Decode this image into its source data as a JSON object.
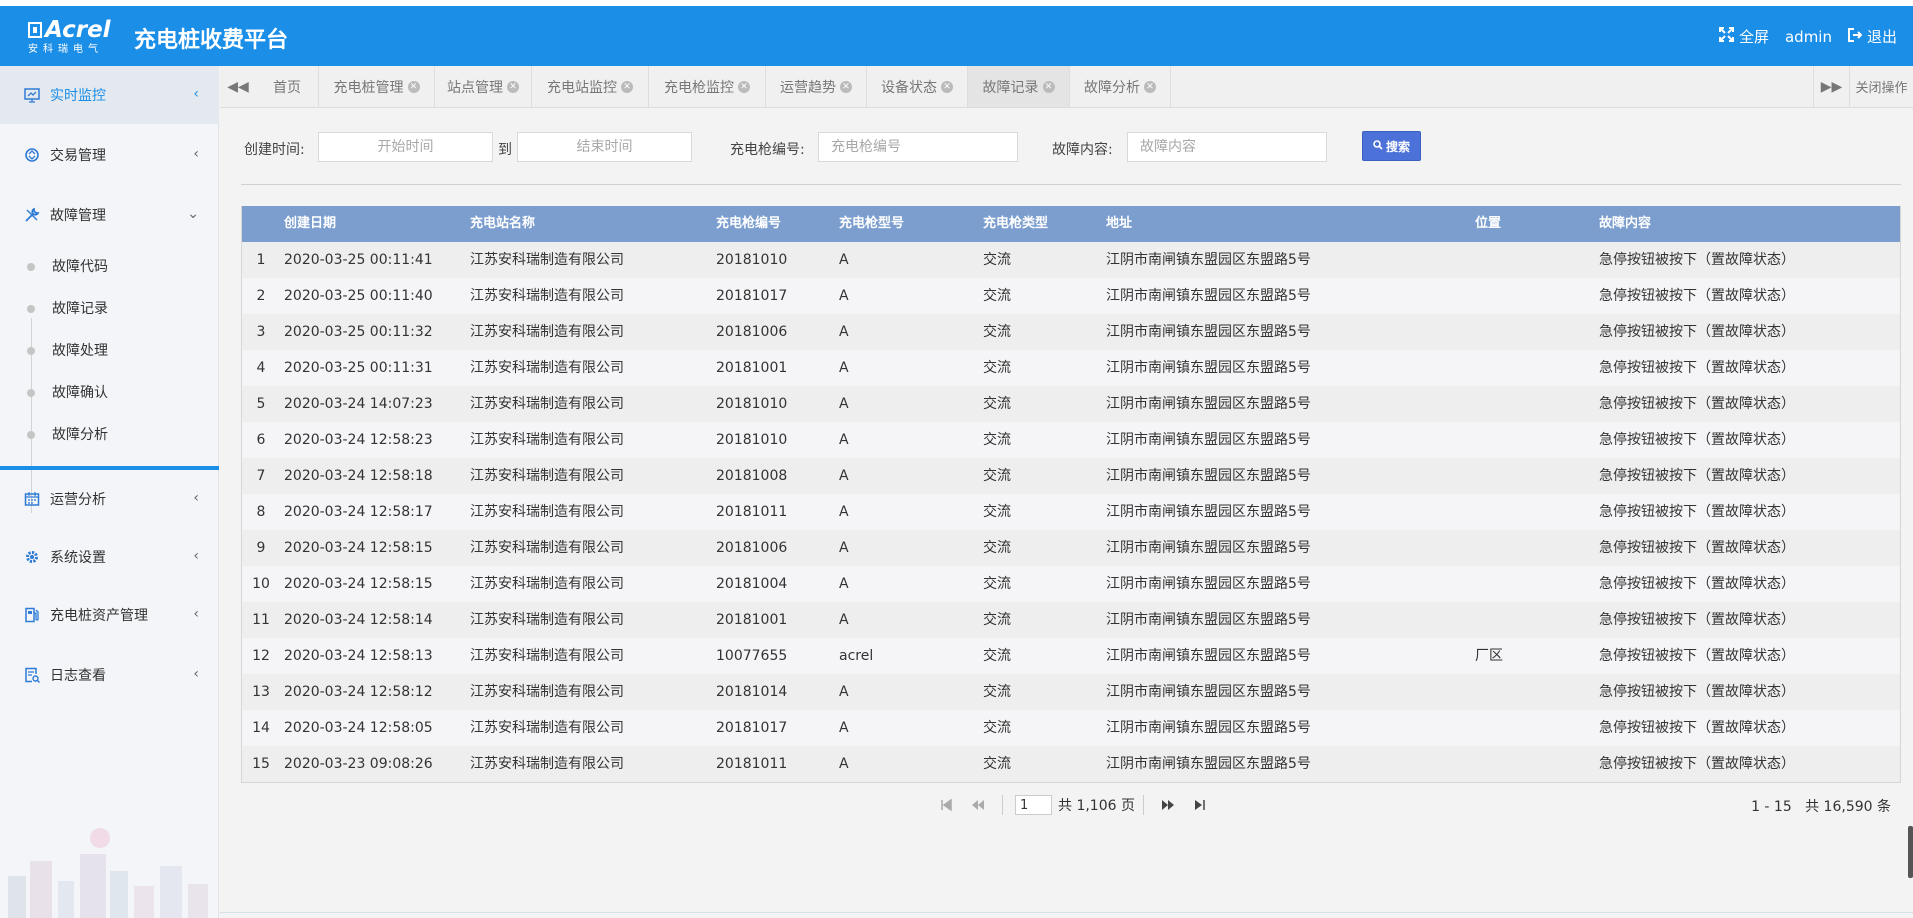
{
  "brand": {
    "logo_text": "Acrel",
    "logo_sub": "安科瑞电气",
    "app_title": "充电桩收费平台"
  },
  "header": {
    "fullscreen_label": "全屏",
    "user": "admin",
    "logout_label": "退出"
  },
  "sidebar": {
    "items": [
      {
        "label": "实时监控",
        "icon": "monitor-icon"
      },
      {
        "label": "交易管理",
        "icon": "exchange-icon"
      },
      {
        "label": "故障管理",
        "icon": "wrench-icon"
      },
      {
        "label": "运营分析",
        "icon": "calendar-icon"
      },
      {
        "label": "系统设置",
        "icon": "gear-icon"
      },
      {
        "label": "充电桩资产管理",
        "icon": "charger-icon"
      },
      {
        "label": "日志查看",
        "icon": "log-icon"
      }
    ],
    "sub_items": [
      "故障代码",
      "故障记录",
      "故障处理",
      "故障确认",
      "故障分析"
    ]
  },
  "tabs": {
    "items": [
      "首页",
      "充电桩管理",
      "站点管理",
      "充电站监控",
      "充电枪监控",
      "运营趋势",
      "设备状态",
      "故障记录",
      "故障分析"
    ],
    "active": "故障记录",
    "close_ops_label": "关闭操作"
  },
  "search": {
    "created_label": "创建时间:",
    "start_placeholder": "开始时间",
    "to_label": "到",
    "end_placeholder": "结束时间",
    "gun_label": "充电枪编号:",
    "gun_placeholder": "充电枪编号",
    "fault_label": "故障内容:",
    "fault_placeholder": "故障内容",
    "button_label": "搜索"
  },
  "table": {
    "columns": [
      "创建日期",
      "充电站名称",
      "充电枪编号",
      "充电枪型号",
      "充电枪类型",
      "地址",
      "位置",
      "故障内容"
    ],
    "rows": [
      {
        "n": "1",
        "date": "2020-03-25 00:11:41",
        "station": "江苏安科瑞制造有限公司",
        "gun_no": "20181010",
        "model": "A",
        "type": "交流",
        "address": "江阴市南闸镇东盟园区东盟路5号",
        "location": "",
        "fault": "急停按钮被按下（置故障状态）"
      },
      {
        "n": "2",
        "date": "2020-03-25 00:11:40",
        "station": "江苏安科瑞制造有限公司",
        "gun_no": "20181017",
        "model": "A",
        "type": "交流",
        "address": "江阴市南闸镇东盟园区东盟路5号",
        "location": "",
        "fault": "急停按钮被按下（置故障状态）"
      },
      {
        "n": "3",
        "date": "2020-03-25 00:11:32",
        "station": "江苏安科瑞制造有限公司",
        "gun_no": "20181006",
        "model": "A",
        "type": "交流",
        "address": "江阴市南闸镇东盟园区东盟路5号",
        "location": "",
        "fault": "急停按钮被按下（置故障状态）"
      },
      {
        "n": "4",
        "date": "2020-03-25 00:11:31",
        "station": "江苏安科瑞制造有限公司",
        "gun_no": "20181001",
        "model": "A",
        "type": "交流",
        "address": "江阴市南闸镇东盟园区东盟路5号",
        "location": "",
        "fault": "急停按钮被按下（置故障状态）"
      },
      {
        "n": "5",
        "date": "2020-03-24 14:07:23",
        "station": "江苏安科瑞制造有限公司",
        "gun_no": "20181010",
        "model": "A",
        "type": "交流",
        "address": "江阴市南闸镇东盟园区东盟路5号",
        "location": "",
        "fault": "急停按钮被按下（置故障状态）"
      },
      {
        "n": "6",
        "date": "2020-03-24 12:58:23",
        "station": "江苏安科瑞制造有限公司",
        "gun_no": "20181010",
        "model": "A",
        "type": "交流",
        "address": "江阴市南闸镇东盟园区东盟路5号",
        "location": "",
        "fault": "急停按钮被按下（置故障状态）"
      },
      {
        "n": "7",
        "date": "2020-03-24 12:58:18",
        "station": "江苏安科瑞制造有限公司",
        "gun_no": "20181008",
        "model": "A",
        "type": "交流",
        "address": "江阴市南闸镇东盟园区东盟路5号",
        "location": "",
        "fault": "急停按钮被按下（置故障状态）"
      },
      {
        "n": "8",
        "date": "2020-03-24 12:58:17",
        "station": "江苏安科瑞制造有限公司",
        "gun_no": "20181011",
        "model": "A",
        "type": "交流",
        "address": "江阴市南闸镇东盟园区东盟路5号",
        "location": "",
        "fault": "急停按钮被按下（置故障状态）"
      },
      {
        "n": "9",
        "date": "2020-03-24 12:58:15",
        "station": "江苏安科瑞制造有限公司",
        "gun_no": "20181006",
        "model": "A",
        "type": "交流",
        "address": "江阴市南闸镇东盟园区东盟路5号",
        "location": "",
        "fault": "急停按钮被按下（置故障状态）"
      },
      {
        "n": "10",
        "date": "2020-03-24 12:58:15",
        "station": "江苏安科瑞制造有限公司",
        "gun_no": "20181004",
        "model": "A",
        "type": "交流",
        "address": "江阴市南闸镇东盟园区东盟路5号",
        "location": "",
        "fault": "急停按钮被按下（置故障状态）"
      },
      {
        "n": "11",
        "date": "2020-03-24 12:58:14",
        "station": "江苏安科瑞制造有限公司",
        "gun_no": "20181001",
        "model": "A",
        "type": "交流",
        "address": "江阴市南闸镇东盟园区东盟路5号",
        "location": "",
        "fault": "急停按钮被按下（置故障状态）"
      },
      {
        "n": "12",
        "date": "2020-03-24 12:58:13",
        "station": "江苏安科瑞制造有限公司",
        "gun_no": "10077655",
        "model": "acrel",
        "type": "交流",
        "address": "江阴市南闸镇东盟园区东盟路5号",
        "location": "厂区",
        "fault": "急停按钮被按下（置故障状态）"
      },
      {
        "n": "13",
        "date": "2020-03-24 12:58:12",
        "station": "江苏安科瑞制造有限公司",
        "gun_no": "20181014",
        "model": "A",
        "type": "交流",
        "address": "江阴市南闸镇东盟园区东盟路5号",
        "location": "",
        "fault": "急停按钮被按下（置故障状态）"
      },
      {
        "n": "14",
        "date": "2020-03-24 12:58:05",
        "station": "江苏安科瑞制造有限公司",
        "gun_no": "20181017",
        "model": "A",
        "type": "交流",
        "address": "江阴市南闸镇东盟园区东盟路5号",
        "location": "",
        "fault": "急停按钮被按下（置故障状态）"
      },
      {
        "n": "15",
        "date": "2020-03-23 09:08:26",
        "station": "江苏安科瑞制造有限公司",
        "gun_no": "20181011",
        "model": "A",
        "type": "交流",
        "address": "江阴市南闸镇东盟园区东盟路5号",
        "location": "",
        "fault": "急停按钮被按下（置故障状态）"
      }
    ]
  },
  "pagination": {
    "current_page": "1",
    "total_pages_text": "共 1,106 页",
    "range_text": "1 - 15",
    "total_records_text": "共 16,590 条"
  },
  "colors": {
    "header": "#1b8ee8",
    "table_header": "#7c9ecf",
    "search_button": "#4c72d9"
  }
}
